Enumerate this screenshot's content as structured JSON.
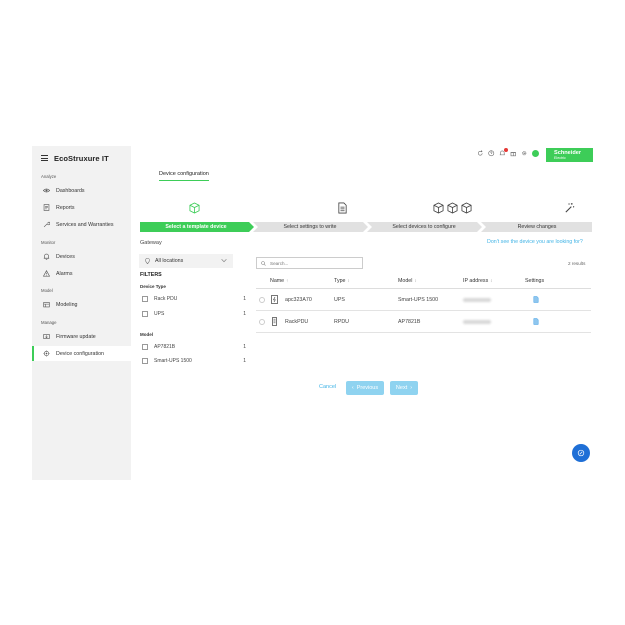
{
  "app": {
    "brand": "EcoStruxure IT"
  },
  "sidebar": {
    "sections": [
      {
        "label": "Analyze",
        "items": [
          {
            "label": "Dashboards",
            "icon": "eye-icon"
          },
          {
            "label": "Reports",
            "icon": "report-icon"
          },
          {
            "label": "Services and Warranties",
            "icon": "service-icon"
          }
        ]
      },
      {
        "label": "Monitor",
        "items": [
          {
            "label": "Devices",
            "icon": "bell-icon"
          },
          {
            "label": "Alarms",
            "icon": "warning-icon"
          }
        ]
      },
      {
        "label": "Model",
        "items": [
          {
            "label": "Modeling",
            "icon": "model-icon"
          }
        ]
      },
      {
        "label": "Manage",
        "items": [
          {
            "label": "Firmware update",
            "icon": "firmware-icon"
          },
          {
            "label": "Device configuration",
            "icon": "config-icon",
            "active": true
          }
        ]
      }
    ]
  },
  "header": {
    "logo_name": "Schneider",
    "logo_sub": "Electric",
    "notification_count": 1,
    "accent_color": "#3dcd58"
  },
  "page": {
    "tab": "Device configuration",
    "gateway_label": "Gateway",
    "help_link": "Don't see the device you are looking for?"
  },
  "steps": [
    {
      "label": "Select a template device",
      "active": true
    },
    {
      "label": "Select settings to write",
      "active": false
    },
    {
      "label": "Select devices to configure",
      "active": false
    },
    {
      "label": "Review changes",
      "active": false
    }
  ],
  "filters": {
    "location": "All locations",
    "title": "FILTERS",
    "groups": [
      {
        "label": "Device Type",
        "options": [
          {
            "label": "Rack PDU",
            "count": "1"
          },
          {
            "label": "UPS",
            "count": "1"
          }
        ]
      },
      {
        "label": "Model",
        "options": [
          {
            "label": "AP7821B",
            "count": "1"
          },
          {
            "label": "Smart-UPS 1500",
            "count": "1"
          }
        ]
      }
    ]
  },
  "table": {
    "search_placeholder": "Search...",
    "results": "2 results",
    "columns": [
      "Name",
      "Type",
      "Model",
      "IP address",
      "Settings"
    ],
    "rows": [
      {
        "name": "apc323A70",
        "type": "UPS",
        "model": "Smart-UPS 1500",
        "device_icon": "ups-icon"
      },
      {
        "name": "RackPDU",
        "type": "RPDU",
        "model": "AP7821B",
        "device_icon": "pdu-icon"
      }
    ]
  },
  "pager": {
    "cancel": "Cancel",
    "previous": "Previous",
    "next": "Next"
  }
}
